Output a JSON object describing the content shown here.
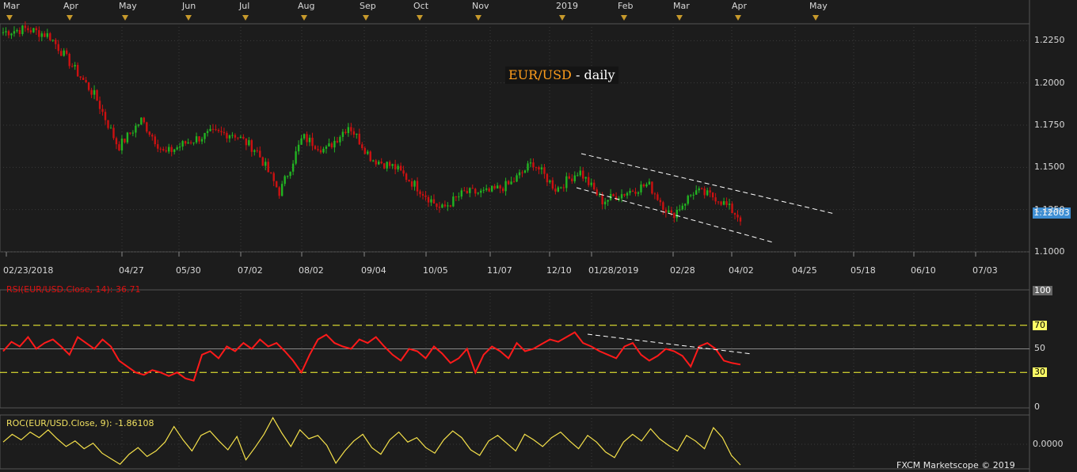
{
  "chart": {
    "title_pair": "EUR/USD",
    "title_timeframe": " - daily",
    "last_price": "1.12003",
    "colors": {
      "up": "#22b422",
      "down": "#cc1111",
      "rsi": "#ff1a1a",
      "roc": "#f4e04a",
      "band": "#ffff33",
      "bg": "#1c1c1c",
      "grid": "#3a3a3a"
    }
  },
  "top_months": [
    "Mar",
    "Apr",
    "May",
    "Jun",
    "Jul",
    "Aug",
    "Sep",
    "Oct",
    "Nov",
    "2019",
    "Feb",
    "Mar",
    "Apr",
    "May"
  ],
  "date_labels": [
    "02/23/2018",
    "04/27",
    "05/30",
    "07/02",
    "08/02",
    "09/04",
    "10/05",
    "11/07",
    "12/10",
    "01/28/2019",
    "02/28",
    "04/02",
    "04/25",
    "05/18",
    "06/10",
    "07/03"
  ],
  "price_axis": [
    "1.2250",
    "1.2000",
    "1.1750",
    "1.1500",
    "1.1250",
    "1.1000"
  ],
  "rsi": {
    "label": "RSI(EUR/USD.Close, 14): 36.71",
    "levels": [
      "100",
      "70",
      "50",
      "30",
      "0"
    ]
  },
  "roc": {
    "label": "ROC(EUR/USD.Close, 9): -1.86108",
    "axis": "0.0000"
  },
  "footer": "FXCM Marketscope © 2019",
  "chart_data": [
    {
      "type": "candlestick",
      "title": "EUR/USD - daily",
      "ylim": [
        1.1,
        1.235
      ],
      "y_ticks": [
        1.225,
        1.2,
        1.175,
        1.15,
        1.125,
        1.1
      ],
      "x_labels": [
        "02/23/2018",
        "04/27",
        "05/30",
        "07/02",
        "08/02",
        "09/04",
        "10/05",
        "11/07",
        "12/10",
        "01/28/2019",
        "02/28",
        "04/02",
        "04/25",
        "05/18",
        "06/10",
        "07/03"
      ],
      "close_path": [
        [
          "02/23/2018",
          1.23
        ],
        [
          "03/15",
          1.232
        ],
        [
          "04/05",
          1.228
        ],
        [
          "04/27",
          1.21
        ],
        [
          "05/10",
          1.192
        ],
        [
          "05/30",
          1.162
        ],
        [
          "06/08",
          1.178
        ],
        [
          "06/20",
          1.158
        ],
        [
          "07/02",
          1.165
        ],
        [
          "07/12",
          1.17
        ],
        [
          "07/25",
          1.17
        ],
        [
          "08/02",
          1.16
        ],
        [
          "08/15",
          1.135
        ],
        [
          "08/28",
          1.168
        ],
        [
          "09/04",
          1.16
        ],
        [
          "09/20",
          1.175
        ],
        [
          "10/05",
          1.155
        ],
        [
          "10/20",
          1.15
        ],
        [
          "11/07",
          1.138
        ],
        [
          "11/13",
          1.125
        ],
        [
          "11/25",
          1.135
        ],
        [
          "12/10",
          1.135
        ],
        [
          "12/28",
          1.14
        ],
        [
          "01/09/2019",
          1.153
        ],
        [
          "01/20",
          1.137
        ],
        [
          "01/28/2019",
          1.148
        ],
        [
          "02/10",
          1.13
        ],
        [
          "02/20",
          1.135
        ],
        [
          "02/28",
          1.14
        ],
        [
          "03/08",
          1.121
        ],
        [
          "03/20",
          1.136
        ],
        [
          "03/26",
          1.132
        ],
        [
          "04/02",
          1.12
        ]
      ],
      "trend_channel": {
        "upper": [
          [
            1.156,
            "01/04/2019"
          ],
          [
            1.12,
            "05/15"
          ]
        ],
        "lower": [
          [
            1.138,
            "01/04/2019"
          ],
          [
            1.102,
            "04/28"
          ]
        ]
      },
      "last": 1.12003
    },
    {
      "type": "line",
      "title": "RSI(EUR/USD.Close, 14): 36.71",
      "ylim": [
        0,
        100
      ],
      "levels": [
        70,
        50,
        30
      ],
      "last": 36.71,
      "y": [
        48,
        56,
        52,
        60,
        50,
        55,
        58,
        52,
        45,
        60,
        55,
        50,
        58,
        52,
        40,
        35,
        30,
        28,
        32,
        30,
        27,
        30,
        25,
        23,
        45,
        48,
        42,
        52,
        48,
        55,
        50,
        58,
        52,
        55,
        48,
        40,
        30,
        45,
        58,
        62,
        55,
        52,
        50,
        58,
        55,
        60,
        52,
        45,
        40,
        50,
        48,
        42,
        52,
        46,
        38,
        42,
        50,
        30,
        45,
        52,
        48,
        42,
        55,
        48,
        50,
        54,
        58,
        56,
        60,
        64,
        55,
        52,
        48,
        45,
        42,
        52,
        55,
        45,
        40,
        44,
        50,
        48,
        44,
        35,
        52,
        55,
        50,
        40,
        38,
        36.71
      ]
    },
    {
      "type": "line",
      "title": "ROC(EUR/USD.Close, 9): -1.86108",
      "y_ticks": [
        0.0
      ],
      "last": -1.86108,
      "y": [
        0.2,
        0.9,
        0.4,
        1.1,
        0.6,
        1.3,
        0.5,
        -0.2,
        0.3,
        -0.4,
        0.1,
        -0.8,
        -1.3,
        -1.8,
        -0.9,
        -0.3,
        -1.1,
        -0.6,
        0.2,
        1.6,
        0.4,
        -0.6,
        0.8,
        1.2,
        0.3,
        -0.5,
        0.7,
        -1.4,
        -0.3,
        0.9,
        2.4,
        1.0,
        -0.2,
        1.3,
        0.5,
        0.8,
        -0.1,
        -1.7,
        -0.6,
        0.3,
        0.9,
        -0.3,
        -0.9,
        0.4,
        1.1,
        0.2,
        0.6,
        -0.3,
        -0.8,
        0.4,
        1.2,
        0.6,
        -0.5,
        -1.0,
        0.3,
        0.8,
        0.1,
        -0.6,
        0.9,
        0.4,
        -0.2,
        0.6,
        1.1,
        0.3,
        -0.4,
        0.8,
        0.2,
        -0.7,
        -1.2,
        0.2,
        0.9,
        0.3,
        1.4,
        0.5,
        -0.1,
        -0.6,
        0.8,
        0.3,
        -0.4,
        1.5,
        0.6,
        -1.0,
        -1.86108
      ]
    }
  ]
}
